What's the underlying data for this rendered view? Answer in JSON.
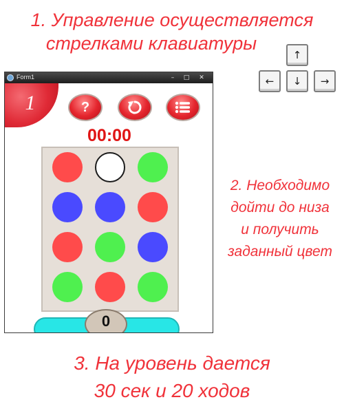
{
  "instructions": {
    "line1a": "1. Управление осуществляется",
    "line1b": "стрелками клавиатуры",
    "line2": [
      "2. Необходимо",
      "дойти до низа",
      "и получить",
      "заданный цвет"
    ],
    "line3a": "3. На уровень дается",
    "line3b": "30 сек и 20 ходов"
  },
  "arrow_keys": {
    "up": "↑",
    "left": "←",
    "down": "↓",
    "right": "→"
  },
  "window": {
    "title": "Form1",
    "controls": {
      "minimize": "–",
      "maximize": "□",
      "close": "✕"
    }
  },
  "game": {
    "level": "1",
    "timer": "00:00",
    "moves": "0",
    "buttons": {
      "help": {
        "label": "?",
        "icon": "question-icon"
      },
      "restart": {
        "icon": "restart-icon"
      },
      "menu": {
        "icon": "menu-list-icon"
      }
    },
    "board": [
      [
        "red",
        "white",
        "green"
      ],
      [
        "blue",
        "blue",
        "red"
      ],
      [
        "red",
        "green",
        "blue"
      ],
      [
        "green",
        "red",
        "green"
      ]
    ]
  },
  "colors": {
    "accent_text": "#f0323a",
    "red": "#ff4b4b",
    "green": "#4ff04f",
    "blue": "#4a4aff",
    "white": "#ffffff",
    "board_bg": "#e6dfd8",
    "bottom_bar": "#28e6e6"
  }
}
